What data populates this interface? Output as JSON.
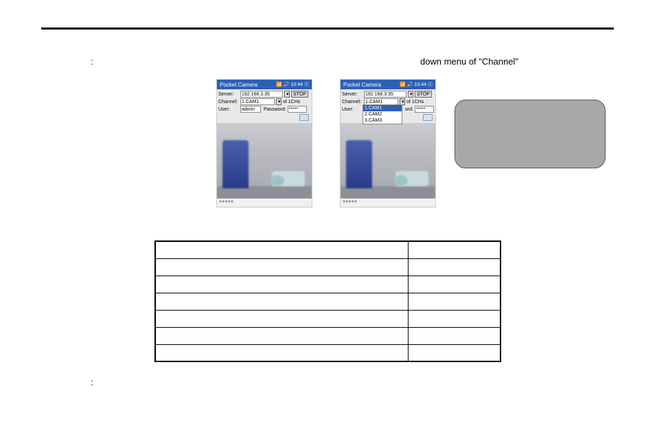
{
  "text": {
    "colon1": ":",
    "line1_right": "down menu of \"Channel\"",
    "colon2": ":"
  },
  "pda": {
    "title": "Pocket Camera",
    "status_icons": "📶 🔊 10:44 ⓧ",
    "server_label": "Server:",
    "server_value": "192.168.3.35",
    "stop": "STOP",
    "channel_label": "Channel:",
    "channel_value": "1.CAM1",
    "of_suffix": "of 1CHs",
    "user_label": "User:",
    "user_value": "admin",
    "password_label": "Password:",
    "password_value": "*****",
    "dropdown_options": [
      "1.CAM1",
      "2.CAM2",
      "3.CAM3"
    ],
    "dropdown_selected_index": 0,
    "ord_label": "ord:",
    "bottom_dots": "●●●●●"
  },
  "table": {
    "rows": [
      [
        "",
        ""
      ],
      [
        "",
        ""
      ],
      [
        "",
        ""
      ],
      [
        "",
        ""
      ],
      [
        "",
        ""
      ],
      [
        "",
        ""
      ],
      [
        "",
        ""
      ]
    ]
  }
}
